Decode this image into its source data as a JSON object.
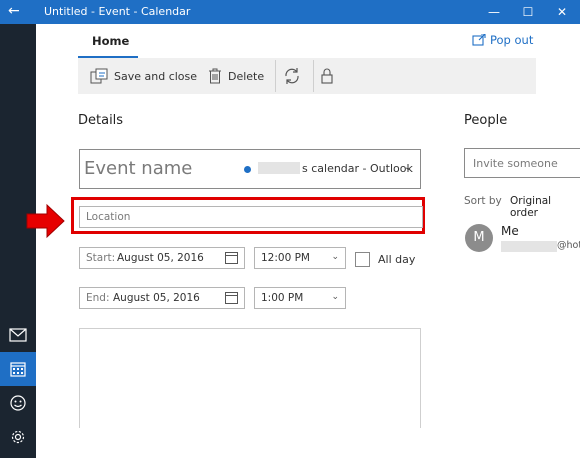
{
  "window": {
    "title": "Untitled - Event - Calendar",
    "back_glyph": "←",
    "minimize_glyph": "—",
    "maximize_glyph": "☐",
    "close_glyph": "✕"
  },
  "tabs": [
    {
      "label": "Home"
    }
  ],
  "popout_label": "Pop out",
  "toolbar": {
    "save_label": "Save and close",
    "delete_label": "Delete"
  },
  "details": {
    "heading": "Details",
    "event_name_placeholder": "Event name",
    "calendar_label": "s calendar - Outlook",
    "location_placeholder": "Location",
    "start": {
      "label": "Start:",
      "date": "August 05, 2016",
      "time": "12:00 PM"
    },
    "end": {
      "label": "End:",
      "date": "August 05, 2016",
      "time": "1:00 PM"
    },
    "all_day_label": "All day"
  },
  "people": {
    "heading": "People",
    "invite_placeholder": "Invite someone",
    "sort_label": "Sort by",
    "sort_value": "Original order",
    "attendee": {
      "initial": "M",
      "name": "Me",
      "email_suffix": "@hot"
    }
  },
  "icons": {
    "rail": [
      "mail-icon",
      "calendar-icon",
      "smiley-icon",
      "settings-icon"
    ],
    "toolbar": [
      "save-icon",
      "trash-icon",
      "refresh-icon",
      "lock-icon"
    ]
  },
  "colors": {
    "accent": "#1f6fc5",
    "rail": "#1b2530",
    "highlight": "#e00000"
  }
}
